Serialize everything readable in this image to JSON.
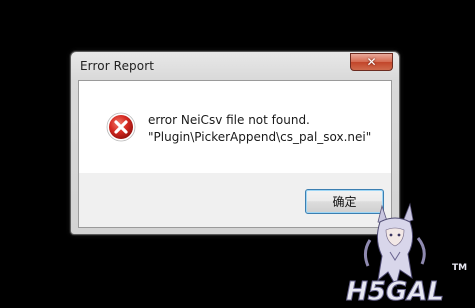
{
  "dialog": {
    "title": "Error Report",
    "close_glyph": "✕",
    "icon": "error-icon",
    "message_line1": "error NeiCsv file not found.",
    "message_line2": "\"Plugin\\PickerAppend\\cs_pal_sox.nei\"",
    "ok_label": "确定"
  },
  "watermark": {
    "logo_text": "H5GAL",
    "trademark": "TM"
  },
  "colors": {
    "background": "#000000",
    "error_red": "#d62a22",
    "close_red": "#c7472c",
    "ok_border": "#3c7fb1"
  }
}
